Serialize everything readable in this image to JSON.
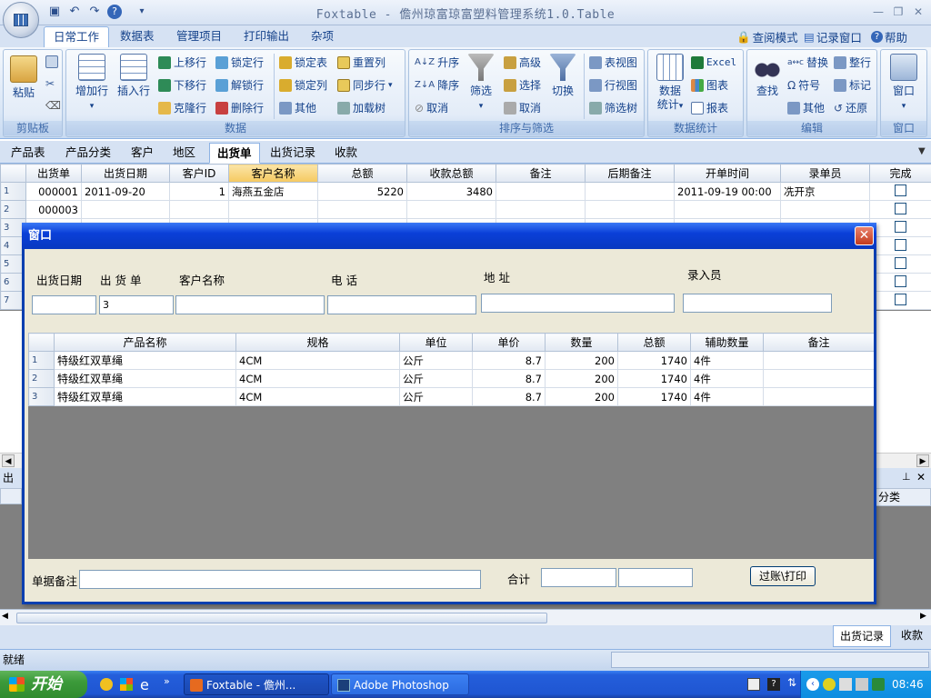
{
  "window": {
    "title": "Foxtable - 儋州琼富琼富塑料管理系统1.0.Table",
    "qat_icons": [
      "save-icon",
      "undo-icon",
      "redo-icon",
      "help-icon",
      "dropdown-icon"
    ]
  },
  "ribbon": {
    "tabs": [
      "日常工作",
      "数据表",
      "管理项目",
      "打印输出",
      "杂项"
    ],
    "active_tab": "日常工作",
    "right_links": [
      {
        "label": "查阅模式",
        "icon": "lock-icon"
      },
      {
        "label": "记录窗口",
        "icon": "window-icon"
      },
      {
        "label": "帮助",
        "icon": "help-icon"
      }
    ],
    "groups": {
      "clipboard": {
        "label": "剪贴板",
        "paste": "粘贴"
      },
      "data": {
        "label": "数据",
        "add_row": "增加行",
        "insert_row": "插入行",
        "move_up": "上移行",
        "move_down": "下移行",
        "clone_row": "克隆行",
        "lock_row": "锁定行",
        "unlock_row": "解锁行",
        "delete_row": "删除行",
        "lock_table": "锁定表",
        "lock_col": "锁定列",
        "other": "其他",
        "reset_col": "重置列",
        "sync_row": "同步行",
        "load_tree": "加载树"
      },
      "sort_filter": {
        "label": "排序与筛选",
        "asc": "升序",
        "desc": "降序",
        "cancel": "取消",
        "filter": "筛选",
        "advanced": "高级",
        "select": "选择",
        "cancel2": "取消",
        "switch": "切换",
        "table_view": "表视图",
        "row_view": "行视图",
        "filter_tree": "筛选树"
      },
      "stats": {
        "label": "数据统计",
        "stats": "数据\n统计",
        "excel": "Excel",
        "chart": "图表",
        "report": "报表"
      },
      "edit": {
        "label": "编辑",
        "find": "查找",
        "replace": "替换",
        "symbol": "符号",
        "other": "其他",
        "tidy": "整行",
        "mark": "标记",
        "restore": "还原"
      },
      "window": {
        "label": "窗口",
        "window": "窗口"
      }
    }
  },
  "doc_tabs": [
    "产品表",
    "产品分类",
    "客户",
    "地区",
    "出货单",
    "出货记录",
    "收款"
  ],
  "active_doc_tab": "出货单",
  "main_grid": {
    "columns": [
      "出货单",
      "出货日期",
      "客户ID",
      "客户名称",
      "总额",
      "收款总额",
      "备注",
      "后期备注",
      "开单时间",
      "录单员",
      "完成"
    ],
    "rows": [
      {
        "n": "1",
        "c": [
          "000001",
          "2011-09-20",
          "1",
          "海燕五金店",
          "5220",
          "3480",
          "",
          "",
          "2011-09-19 00:00",
          "冼开京",
          ""
        ]
      },
      {
        "n": "2",
        "c": [
          "000003",
          "",
          "",
          "",
          "",
          "",
          "",
          "",
          "",
          "",
          ""
        ]
      },
      {
        "n": "3",
        "c": [
          "",
          "",
          "",
          "",
          "",
          "",
          "",
          "",
          "",
          "",
          ""
        ]
      },
      {
        "n": "4",
        "c": [
          "",
          "",
          "",
          "",
          "",
          "",
          "",
          "",
          "",
          "",
          ""
        ]
      },
      {
        "n": "5",
        "c": [
          "",
          "",
          "",
          "",
          "",
          "",
          "",
          "",
          "",
          "",
          ""
        ]
      },
      {
        "n": "6",
        "c": [
          "",
          "",
          "",
          "",
          "",
          "",
          "",
          "",
          "",
          "",
          ""
        ]
      },
      {
        "n": "7",
        "c": [
          "",
          "",
          "",
          "",
          "",
          "",
          "",
          "",
          "",
          "",
          ""
        ]
      }
    ]
  },
  "dialog": {
    "title": "窗口",
    "fields": {
      "ship_date": {
        "label": "出货日期",
        "value": ""
      },
      "order_no": {
        "label": "出 货 单",
        "value": "3"
      },
      "customer": {
        "label": "客户名称",
        "value": ""
      },
      "phone": {
        "label": "电  话",
        "value": ""
      },
      "address": {
        "label": "地  址",
        "value": ""
      },
      "clerk": {
        "label": "录入员",
        "value": ""
      }
    },
    "grid": {
      "columns": [
        "产品名称",
        "规格",
        "单位",
        "单价",
        "数量",
        "总额",
        "辅助数量",
        "备注"
      ],
      "rows": [
        {
          "n": "1",
          "c": [
            "特级红双草绳",
            "4CM",
            "公斤",
            "8.7",
            "200",
            "1740",
            "4件",
            ""
          ]
        },
        {
          "n": "2",
          "c": [
            "特级红双草绳",
            "4CM",
            "公斤",
            "8.7",
            "200",
            "1740",
            "4件",
            ""
          ]
        },
        {
          "n": "3",
          "c": [
            "特级红双草绳",
            "4CM",
            "公斤",
            "8.7",
            "200",
            "1740",
            "4件",
            ""
          ]
        }
      ]
    },
    "remark_label": "单据备注",
    "remark_value": "",
    "total_label": "合计",
    "total_1": "",
    "total_2": "",
    "post_print_button": "过账\\打印"
  },
  "lower_panel": {
    "left_label": "出货",
    "right_label": "分类"
  },
  "bottom_tabs": [
    "出货记录",
    "收款"
  ],
  "status": {
    "text": "就绪"
  },
  "taskbar": {
    "start": "开始",
    "tasks": [
      {
        "label": "Foxtable - 儋州...",
        "icon": "foxtable-icon"
      },
      {
        "label": "Adobe Photoshop",
        "icon": "photoshop-icon"
      }
    ],
    "clock": "08:46"
  }
}
